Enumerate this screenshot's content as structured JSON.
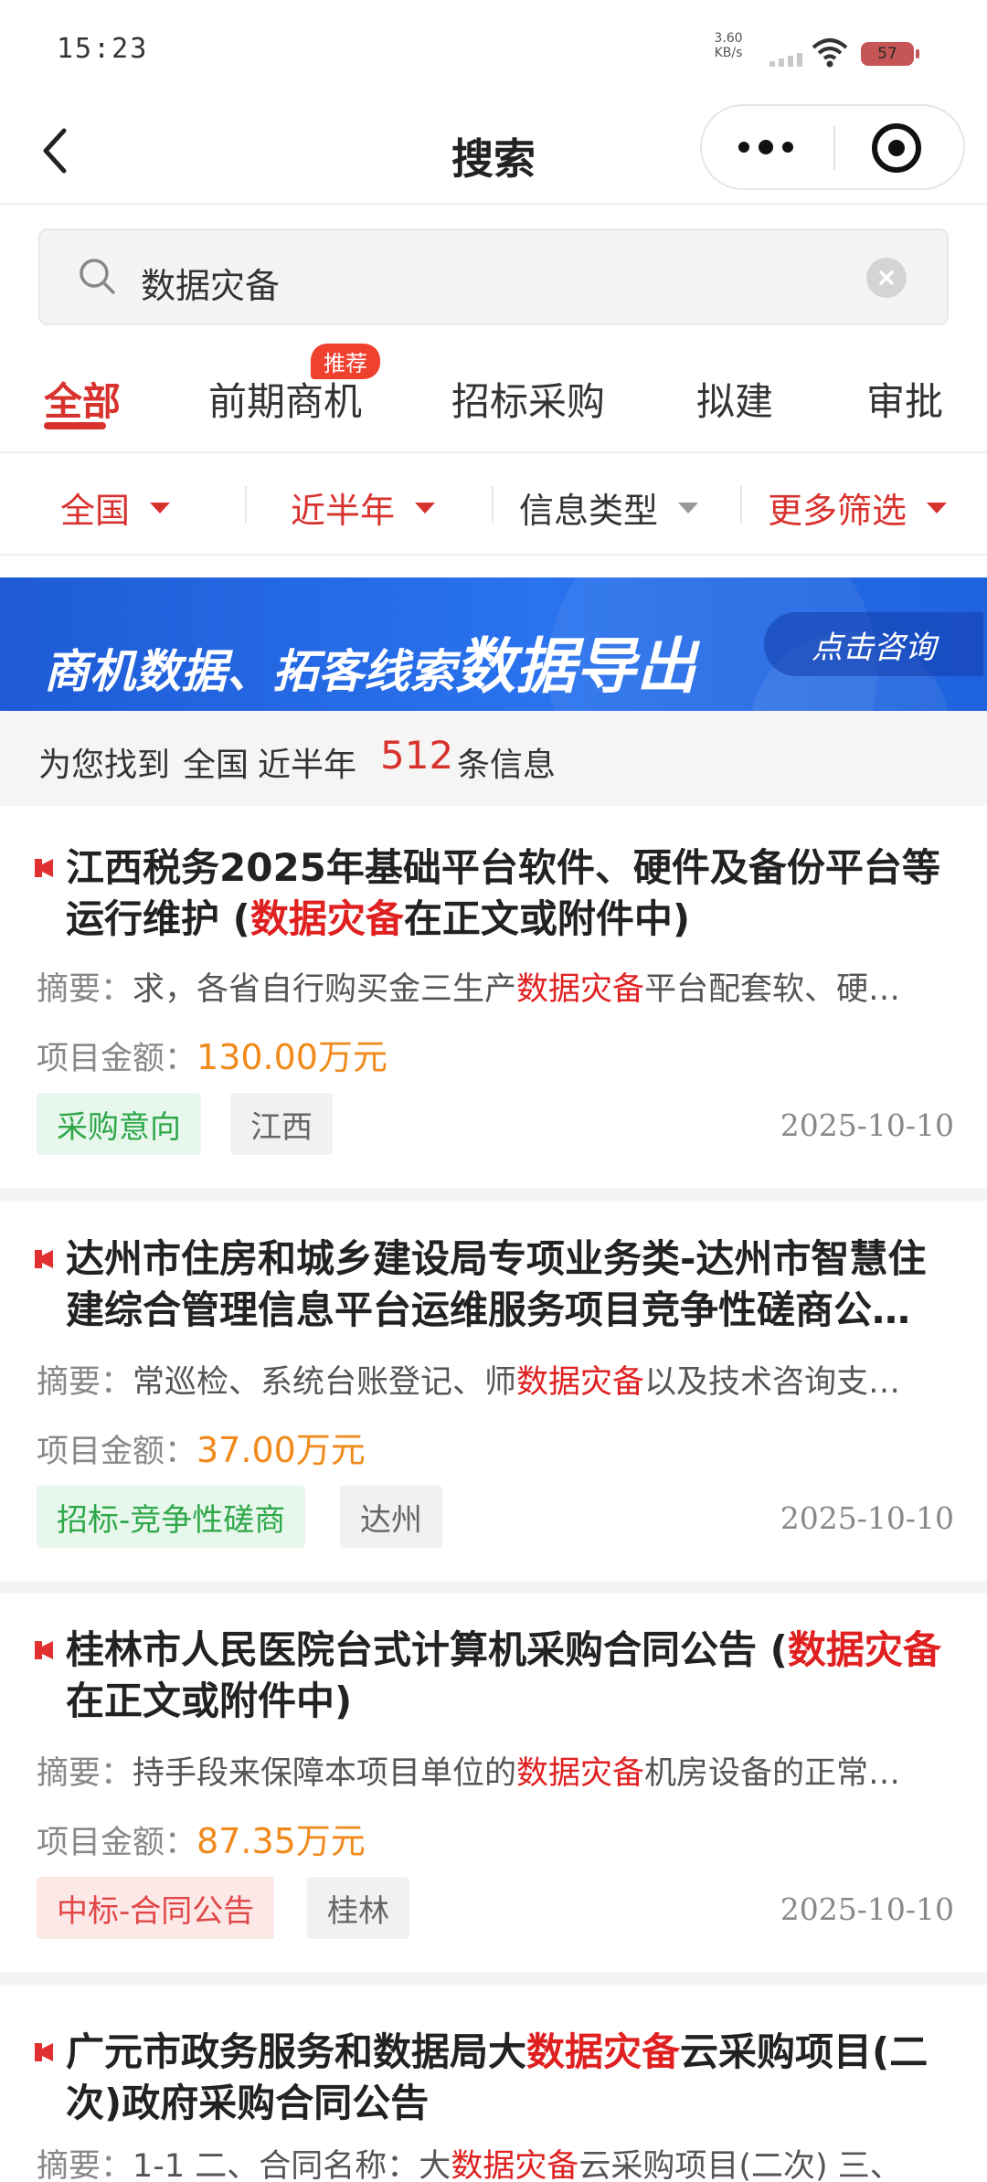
{
  "status_bar": {
    "time": "15:23",
    "net_speed_value": "3.60",
    "net_speed_unit": "KB/s",
    "battery": "57"
  },
  "nav": {
    "title": "搜索"
  },
  "search": {
    "query": "数据灾备"
  },
  "tabs": [
    {
      "label": "全部",
      "active": true
    },
    {
      "label": "前期商机",
      "badge": "推荐"
    },
    {
      "label": "招标采购"
    },
    {
      "label": "拟建"
    },
    {
      "label": "审批"
    }
  ],
  "filters": [
    {
      "label": "全国",
      "color": "#d8322e"
    },
    {
      "label": "近半年",
      "color": "#d8322e"
    },
    {
      "label": "信息类型",
      "color": "#333333"
    },
    {
      "label": "更多筛选",
      "color": "#d8322e"
    }
  ],
  "banner": {
    "text_main": "商机数据、拓客线索",
    "text_emph": "数据导出",
    "button": "点击咨询"
  },
  "result_count": {
    "prefix": "为您找到",
    "region": "全国",
    "period": "近半年",
    "count": "512",
    "suffix": "条信息"
  },
  "results": [
    {
      "title_before": "江西税务2025年基础平台软件、硬件及备份平台等运行维护 (",
      "title_highlight": "数据灾备",
      "title_after": "在正文或附件中)",
      "summary_label": "摘要：",
      "summary_before": "求，各省自行购买金三生产",
      "summary_highlight": "数据灾备",
      "summary_after": "平台配套软、硬…",
      "amount_label": "项目金额：",
      "amount": "130.00万元",
      "tag1": "采购意向",
      "tag2": "江西",
      "date": "2025-10-10"
    },
    {
      "title_before": "达州市住房和城乡建设局专项业务类-达州市智慧住建综合管理信息平台运维服务项目竞争性磋商公…",
      "title_highlight": "",
      "title_after": "",
      "summary_label": "摘要：",
      "summary_before": "常巡检、系统台账登记、师",
      "summary_highlight": "数据灾备",
      "summary_after": "以及技术咨询支…",
      "amount_label": "项目金额：",
      "amount": "37.00万元",
      "tag1": "招标-竞争性磋商",
      "tag2": "达州",
      "date": "2025-10-10"
    },
    {
      "title_before": "桂林市人民医院台式计算机采购合同公告 (",
      "title_highlight": "数据灾备",
      "title_after": "在正文或附件中)",
      "summary_label": "摘要：",
      "summary_before": "持手段来保障本项目单位的",
      "summary_highlight": "数据灾备",
      "summary_after": "机房设备的正常…",
      "amount_label": "项目金额：",
      "amount": "87.35万元",
      "tag1": "中标-合同公告",
      "tag2": "桂林",
      "date": "2025-10-10"
    },
    {
      "title_before": "广元市政务服务和数据局大",
      "title_highlight": "数据灾备",
      "title_after": "云采购项目(二次)政府采购合同公告",
      "summary_label": "摘要：",
      "summary_before": "1-1 二、合同名称：大",
      "summary_highlight": "数据灾备",
      "summary_after": "云采购项目(二次) 三、"
    }
  ]
}
